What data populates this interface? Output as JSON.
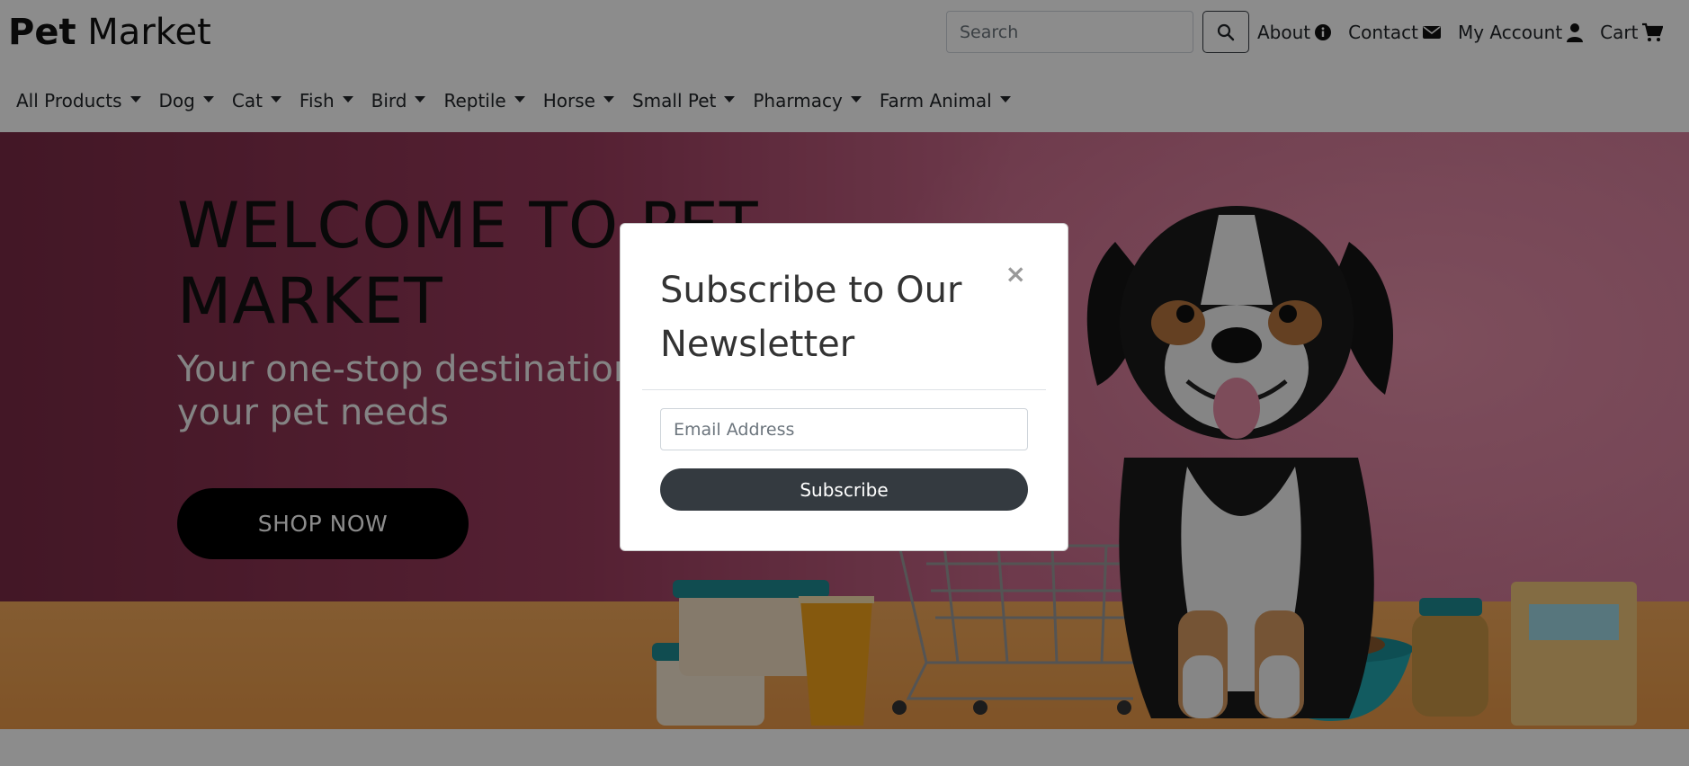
{
  "header": {
    "brand_bold": "Pet",
    "brand_rest": " Market",
    "search": {
      "placeholder": "Search"
    },
    "links": [
      {
        "label": "About",
        "icon": "info-circle-icon"
      },
      {
        "label": "Contact",
        "icon": "envelope-icon"
      },
      {
        "label": "My Account",
        "icon": "user-icon"
      },
      {
        "label": "Cart",
        "icon": "shopping-cart-icon"
      }
    ]
  },
  "categories": [
    {
      "label": "All Products"
    },
    {
      "label": "Dog"
    },
    {
      "label": "Cat"
    },
    {
      "label": "Fish"
    },
    {
      "label": "Bird"
    },
    {
      "label": "Reptile"
    },
    {
      "label": "Horse"
    },
    {
      "label": "Small Pet"
    },
    {
      "label": "Pharmacy"
    },
    {
      "label": "Farm Animal"
    }
  ],
  "hero": {
    "title": "WELCOME TO PET MARKET",
    "subtitle": "Your one-stop destination for all your pet needs",
    "cta": "SHOP NOW"
  },
  "modal": {
    "title": "Subscribe to Our Newsletter",
    "close": "×",
    "email_placeholder": "Email Address",
    "button": "Subscribe"
  }
}
